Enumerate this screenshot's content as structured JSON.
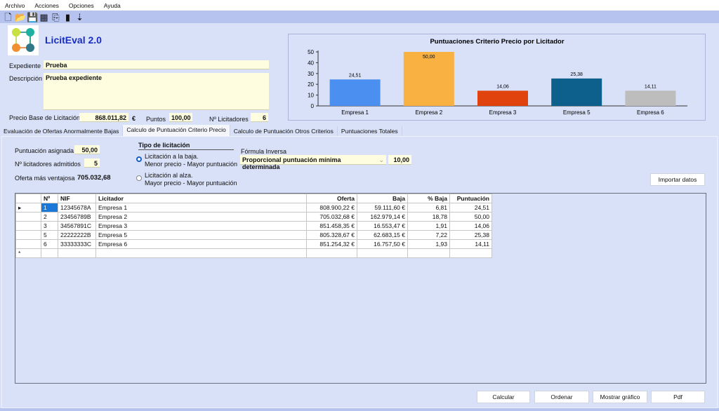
{
  "menu": [
    "Archivo",
    "Acciones",
    "Opciones",
    "Ayuda"
  ],
  "toolbar": [
    {
      "icon": "new-file-icon",
      "glyph": "🗋"
    },
    {
      "icon": "open-folder-icon",
      "glyph": "📂"
    },
    {
      "icon": "save-icon",
      "glyph": "💾"
    },
    {
      "icon": "calculator-icon",
      "glyph": "▦"
    },
    {
      "icon": "export-icon",
      "glyph": "⎘"
    },
    {
      "icon": "bar-chart-icon",
      "glyph": "▮"
    },
    {
      "icon": "sort-icon",
      "glyph": "⇣"
    }
  ],
  "app": {
    "title": "LicitEval 2.0"
  },
  "form": {
    "expediente_label": "Expediente",
    "expediente": "Prueba",
    "descripcion_label": "Descripción",
    "descripcion": "Prueba expediente",
    "precio_label": "Precio Base de Licitación",
    "precio": "868.011,82",
    "euro": "€",
    "puntos_label": "Puntos",
    "puntos": "100,00",
    "licitadores_label": "Nº Licitadores",
    "licitadores": "6"
  },
  "chart_data": {
    "type": "bar",
    "title": "Puntuaciones Criterio Precio por Licitador",
    "categories": [
      "Empresa 1",
      "Empresa 2",
      "Empresa 3",
      "Empresa 5",
      "Empresa 6"
    ],
    "values": [
      24.51,
      50.0,
      14.06,
      25.38,
      14.11
    ],
    "labels": [
      "24,51",
      "50,00",
      "14,06",
      "25,38",
      "14,11"
    ],
    "colors": [
      "#4b8ff0",
      "#f9b142",
      "#e1430f",
      "#0d5f8c",
      "#bdbdbd"
    ],
    "ylim": [
      0,
      50
    ],
    "yticks": [
      0,
      10,
      20,
      30,
      40,
      50
    ],
    "grid": false,
    "legend": "none"
  },
  "tabs": [
    "Evaluación de Ofertas Anormalmente Bajas",
    "Calculo de Puntuación Criterio Precio",
    "Calculo de Puntuación Otros Criterios",
    "Puntuaciones Totales"
  ],
  "panel": {
    "puntuacion_label": "Puntuación asignada",
    "puntuacion": "50,00",
    "admitidos_label": "Nº licitadores admitidos",
    "admitidos": "5",
    "ventajosa_label": "Oferta más ventajosa",
    "ventajosa": "705.032,68",
    "tipo_label": "Tipo de licitación",
    "baja_l1": "Licitación a la baja.",
    "baja_l2": "Menor precio - Mayor puntuación",
    "alza_l1": "Licitación al alza.",
    "alza_l2": "Mayor precio - Mayor puntuación",
    "formula_label": "Fórmula Inversa",
    "formula": "Proporcional puntuación mínima determinada",
    "formula_value": "10,00",
    "importar": "Importar datos"
  },
  "table": {
    "headers": [
      "Nº",
      "NIF",
      "Licitador",
      "Oferta",
      "Baja",
      "% Baja",
      "Puntuación"
    ],
    "rows": [
      [
        "1",
        "12345678A",
        "Empresa 1",
        "808.900,22 €",
        "59.111,60 €",
        "6,81",
        "24,51"
      ],
      [
        "2",
        "23456789B",
        "Empresa 2",
        "705.032,68 €",
        "162.979,14 €",
        "18,78",
        "50,00"
      ],
      [
        "3",
        "34567891C",
        "Empresa 3",
        "851.458,35 €",
        "16.553,47 €",
        "1,91",
        "14,06"
      ],
      [
        "5",
        "22222222B",
        "Empresa 5",
        "805.328,67 €",
        "62.683,15 €",
        "7,22",
        "25,38"
      ],
      [
        "6",
        "33333333C",
        "Empresa 6",
        "851.254,32 €",
        "16.757,50 €",
        "1,93",
        "14,11"
      ]
    ]
  },
  "buttons": [
    "Calcular",
    "Ordenar",
    "Mostrar gráfico",
    "Pdf"
  ]
}
